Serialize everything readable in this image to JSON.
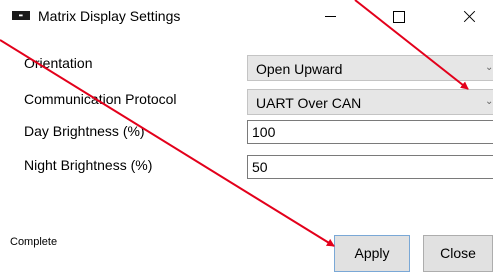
{
  "window": {
    "icon_text": "■",
    "title": "Matrix Display Settings"
  },
  "fields": {
    "orientation": {
      "label": "Orientation",
      "value": "Open Upward"
    },
    "protocol": {
      "label": "Communication Protocol",
      "value": "UART Over CAN"
    },
    "day_brightness": {
      "label": "Day Brightness (%)",
      "value": "100"
    },
    "night_brightness": {
      "label": "Night Brightness (%)",
      "value": "50"
    }
  },
  "status": "Complete",
  "buttons": {
    "apply": "Apply",
    "close": "Close"
  },
  "icons": {
    "chevron": "⌄",
    "app_icon": "app-icon",
    "minimize": "minimize-icon",
    "maximize": "maximize-icon",
    "close": "close-icon"
  },
  "colors": {
    "annotation_arrow": "#e3001b"
  }
}
